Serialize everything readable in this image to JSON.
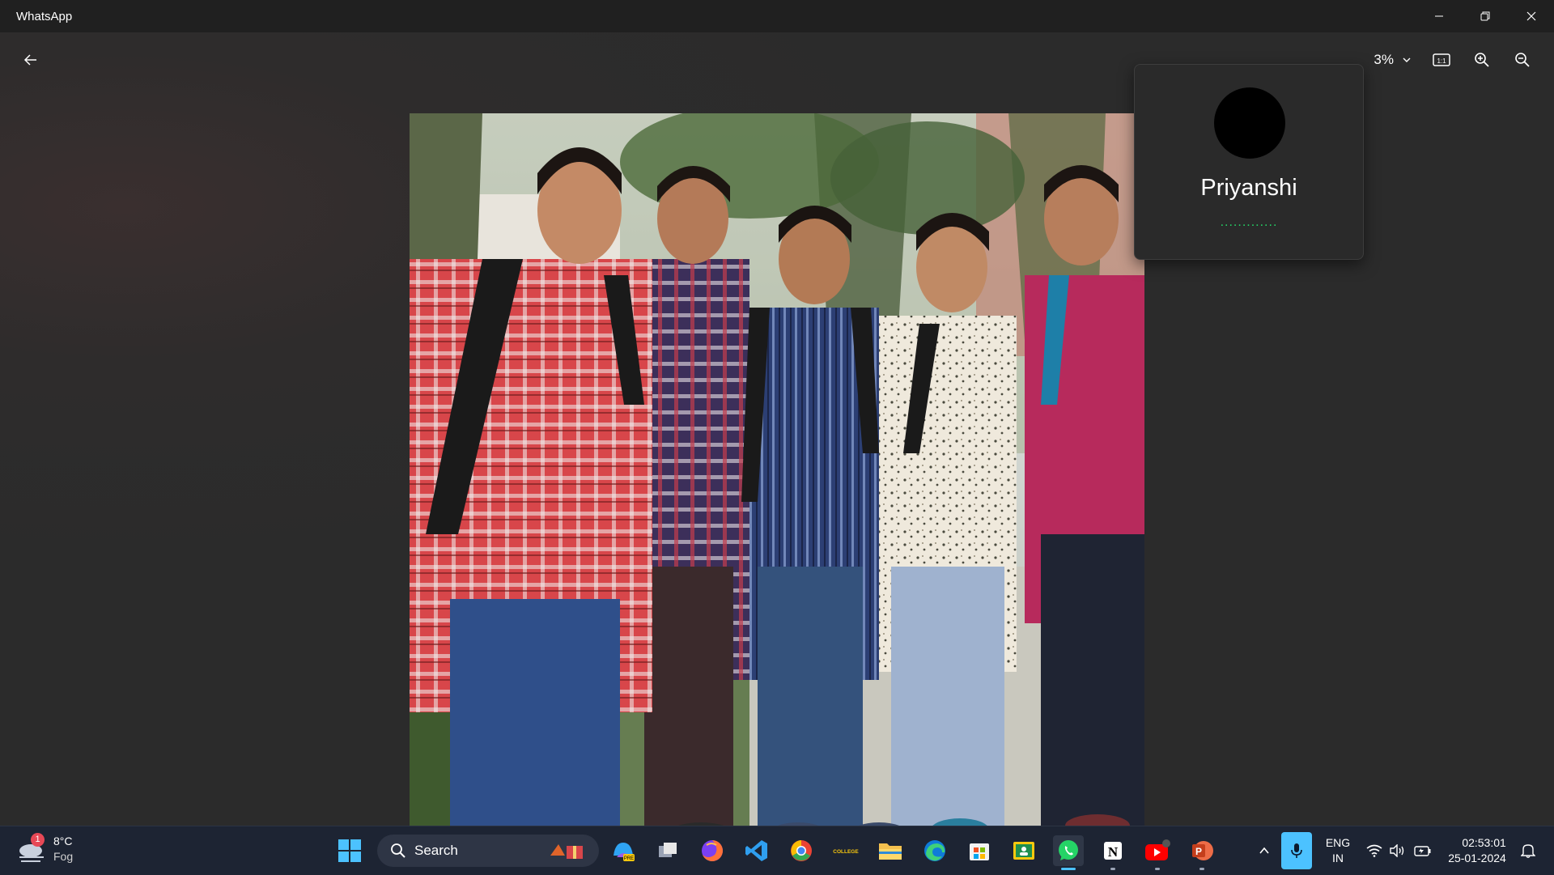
{
  "window": {
    "title": "WhatsApp"
  },
  "viewer": {
    "zoom_label": "3%"
  },
  "contact": {
    "name": "Priyanshi",
    "status": "............."
  },
  "taskbar": {
    "weather": {
      "temp": "8°C",
      "condition": "Fog",
      "badge": "1"
    },
    "search_label": "Search",
    "apps": [
      {
        "name": "copilot-pre"
      },
      {
        "name": "task-view"
      },
      {
        "name": "firefox"
      },
      {
        "name": "vscode"
      },
      {
        "name": "chrome"
      },
      {
        "name": "college"
      },
      {
        "name": "file-explorer"
      },
      {
        "name": "edge"
      },
      {
        "name": "microsoft-store"
      },
      {
        "name": "classroom"
      },
      {
        "name": "whatsapp"
      },
      {
        "name": "notion"
      },
      {
        "name": "youtube"
      },
      {
        "name": "powerpoint"
      }
    ],
    "college_label": "COLLEGE",
    "tray": {
      "lang_top": "ENG",
      "lang_bottom": "IN",
      "time": "02:53:01",
      "date": "25-01-2024"
    }
  },
  "colors": {
    "accent": "#4cc2ff",
    "whatsapp_green": "#25d366",
    "titlebar": "#202020",
    "taskbar": "#1d2433"
  }
}
